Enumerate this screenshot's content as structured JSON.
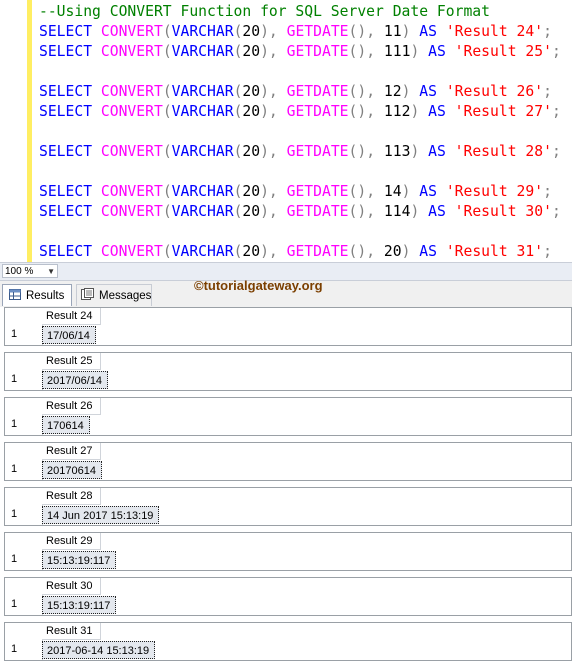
{
  "editor": {
    "comment": "--Using CONVERT Function for SQL Server Date Format",
    "lines": [
      {
        "kind": "comment"
      },
      {
        "kind": "sql",
        "style": "11",
        "alias": "'Result 24'"
      },
      {
        "kind": "sql",
        "style": "111",
        "alias": "'Result 25'"
      },
      {
        "kind": "blank"
      },
      {
        "kind": "sql",
        "style": "12",
        "alias": "'Result 26'"
      },
      {
        "kind": "sql",
        "style": "112",
        "alias": "'Result 27'"
      },
      {
        "kind": "blank"
      },
      {
        "kind": "sql",
        "style": "113",
        "alias": "'Result 28'"
      },
      {
        "kind": "blank"
      },
      {
        "kind": "sql",
        "style": "14",
        "alias": "'Result 29'"
      },
      {
        "kind": "sql",
        "style": "114",
        "alias": "'Result 30'"
      },
      {
        "kind": "blank"
      },
      {
        "kind": "sql",
        "style": "20",
        "alias": "'Result 31'"
      }
    ],
    "tokens": {
      "select": "SELECT",
      "convert": "CONVERT",
      "varchar": "VARCHAR",
      "len": "20",
      "getdate": "GETDATE",
      "as": "AS"
    }
  },
  "zoom": {
    "value": "100 %"
  },
  "tabs": {
    "results": "Results",
    "messages": "Messages"
  },
  "watermark": "©tutorialgateway.org",
  "results": [
    {
      "header": "Result 24",
      "row": "1",
      "value": "17/06/14"
    },
    {
      "header": "Result 25",
      "row": "1",
      "value": "2017/06/14"
    },
    {
      "header": "Result 26",
      "row": "1",
      "value": "170614"
    },
    {
      "header": "Result 27",
      "row": "1",
      "value": "20170614"
    },
    {
      "header": "Result 28",
      "row": "1",
      "value": "14 Jun 2017 15:13:19"
    },
    {
      "header": "Result 29",
      "row": "1",
      "value": "15:13:19:117"
    },
    {
      "header": "Result 30",
      "row": "1",
      "value": "15:13:19:117"
    },
    {
      "header": "Result 31",
      "row": "1",
      "value": "2017-06-14 15:13:19"
    }
  ],
  "colors": {
    "keyword": "#0000ff",
    "function": "#ff00ff",
    "string": "#ff0000",
    "comment": "#008000",
    "gutter": "#ffee62"
  }
}
